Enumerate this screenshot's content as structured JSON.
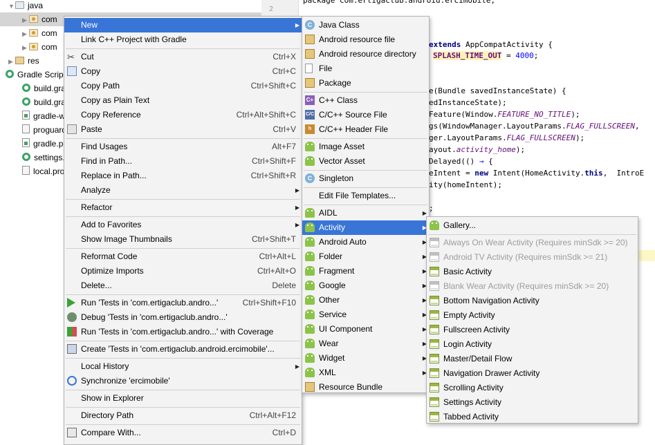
{
  "project_tree": {
    "items": [
      {
        "label": "java",
        "icon": "folder-icon",
        "arrow": "▼"
      },
      {
        "label": "com",
        "icon": "package-icon",
        "arrow": "▶"
      },
      {
        "label": "com",
        "icon": "package-icon",
        "arrow": "▶"
      },
      {
        "label": "com",
        "icon": "package-icon",
        "arrow": "▶"
      },
      {
        "label": "res",
        "icon": "res-folder-icon",
        "arrow": "▶"
      },
      {
        "label": "Gradle Script",
        "icon": "gradle-icon",
        "arrow": ""
      },
      {
        "label": "build.gra",
        "icon": "gradle-ring-icon",
        "arrow": ""
      },
      {
        "label": "build.gra",
        "icon": "gradle-ring-icon",
        "arrow": ""
      },
      {
        "label": "gradle-w",
        "icon": "gradle-file-icon",
        "arrow": ""
      },
      {
        "label": "proguard",
        "icon": "properties-file-icon",
        "arrow": ""
      },
      {
        "label": "gradle.p",
        "icon": "gradle-file-icon",
        "arrow": ""
      },
      {
        "label": "settings.",
        "icon": "gradle-ring-icon",
        "arrow": ""
      },
      {
        "label": "local.pro",
        "icon": "properties-file-icon",
        "arrow": ""
      }
    ]
  },
  "editor": {
    "line_number": "2",
    "lines": [
      {
        "parts": [
          {
            "t": "package com.ertigaclub.android.ercimobile;",
            "c": ""
          }
        ]
      },
      {
        "parts": [
          {
            "t": "extends",
            "c": "kw"
          },
          {
            "t": " AppCompatActivity {",
            "c": ""
          }
        ]
      },
      {
        "parts": [
          {
            "t": "SPLASH_TIME_OUT",
            "c": "st hl"
          },
          {
            "t": " = ",
            "c": ""
          },
          {
            "t": "4000",
            "c": "num"
          },
          {
            "t": ";",
            "c": ""
          }
        ]
      },
      {
        "parts": [
          {
            "t": "e(Bundle savedInstanceState) {",
            "c": ""
          }
        ]
      },
      {
        "parts": [
          {
            "t": "edInstanceState);",
            "c": ""
          }
        ]
      },
      {
        "parts": [
          {
            "t": "Feature(Window.",
            "c": ""
          },
          {
            "t": "FEATURE_NO_TITLE",
            "c": "it"
          },
          {
            "t": ");",
            "c": ""
          }
        ]
      },
      {
        "parts": [
          {
            "t": "gs(WindowManager.LayoutParams.",
            "c": ""
          },
          {
            "t": "FLAG_FULLSCREEN",
            "c": "it"
          },
          {
            "t": ",",
            "c": ""
          }
        ]
      },
      {
        "parts": [
          {
            "t": "ger.LayoutParams.",
            "c": ""
          },
          {
            "t": "FLAG_FULLSCREEN",
            "c": "it"
          },
          {
            "t": ");",
            "c": ""
          }
        ]
      },
      {
        "parts": [
          {
            "t": "ayout.",
            "c": ""
          },
          {
            "t": "activity_home",
            "c": "it"
          },
          {
            "t": ");",
            "c": ""
          }
        ]
      },
      {
        "parts": [
          {
            "t": "Delayed(() ",
            "c": ""
          },
          {
            "t": "→",
            "c": "num"
          },
          {
            "t": " {",
            "c": ""
          }
        ]
      },
      {
        "parts": [
          {
            "t": "eIntent = ",
            "c": ""
          },
          {
            "t": "new",
            "c": "kw"
          },
          {
            "t": " Intent(HomeActivity.",
            "c": ""
          },
          {
            "t": "this",
            "c": "kw"
          },
          {
            "t": ",  IntroE",
            "c": ""
          }
        ]
      },
      {
        "parts": [
          {
            "t": "ity(homeIntent);",
            "c": ""
          }
        ]
      },
      {
        "parts": [
          {
            "t": ";",
            "c": ""
          }
        ]
      }
    ]
  },
  "context_menu": {
    "items": [
      {
        "type": "item",
        "label": "New",
        "highlighted": true,
        "submenu": true
      },
      {
        "type": "item",
        "label": "Link C++ Project with Gradle"
      },
      {
        "type": "sep"
      },
      {
        "type": "item",
        "label": "Cut",
        "shortcut": "Ctrl+X",
        "icon": "cut-icon"
      },
      {
        "type": "item",
        "label": "Copy",
        "shortcut": "Ctrl+C",
        "icon": "copy-icon"
      },
      {
        "type": "item",
        "label": "Copy Path",
        "shortcut": "Ctrl+Shift+C"
      },
      {
        "type": "item",
        "label": "Copy as Plain Text"
      },
      {
        "type": "item",
        "label": "Copy Reference",
        "shortcut": "Ctrl+Alt+Shift+C"
      },
      {
        "type": "item",
        "label": "Paste",
        "shortcut": "Ctrl+V",
        "icon": "paste-icon"
      },
      {
        "type": "sep"
      },
      {
        "type": "item",
        "label": "Find Usages",
        "shortcut": "Alt+F7"
      },
      {
        "type": "item",
        "label": "Find in Path...",
        "shortcut": "Ctrl+Shift+F"
      },
      {
        "type": "item",
        "label": "Replace in Path...",
        "shortcut": "Ctrl+Shift+R"
      },
      {
        "type": "item",
        "label": "Analyze",
        "submenu": true
      },
      {
        "type": "sep"
      },
      {
        "type": "item",
        "label": "Refactor",
        "submenu": true
      },
      {
        "type": "sep"
      },
      {
        "type": "item",
        "label": "Add to Favorites",
        "submenu": true
      },
      {
        "type": "item",
        "label": "Show Image Thumbnails",
        "shortcut": "Ctrl+Shift+T"
      },
      {
        "type": "sep"
      },
      {
        "type": "item",
        "label": "Reformat Code",
        "shortcut": "Ctrl+Alt+L"
      },
      {
        "type": "item",
        "label": "Optimize Imports",
        "shortcut": "Ctrl+Alt+O"
      },
      {
        "type": "item",
        "label": "Delete...",
        "shortcut": "Delete"
      },
      {
        "type": "sep"
      },
      {
        "type": "item",
        "label": "Run 'Tests in 'com.ertigaclub.andro...'",
        "shortcut": "Ctrl+Shift+F10",
        "icon": "run-icon"
      },
      {
        "type": "item",
        "label": "Debug 'Tests in 'com.ertigaclub.andro...'",
        "icon": "debug-icon"
      },
      {
        "type": "item",
        "label": "Run 'Tests in 'com.ertigaclub.andro...' with Coverage",
        "icon": "coverage-icon"
      },
      {
        "type": "sep"
      },
      {
        "type": "item",
        "label": "Create 'Tests in 'com.ertigaclub.android.ercimobile'...",
        "icon": "create-test-icon"
      },
      {
        "type": "sep"
      },
      {
        "type": "item",
        "label": "Local History",
        "submenu": true
      },
      {
        "type": "item",
        "label": "Synchronize 'ercimobile'",
        "icon": "sync-icon"
      },
      {
        "type": "sep"
      },
      {
        "type": "item",
        "label": "Show in Explorer"
      },
      {
        "type": "sep"
      },
      {
        "type": "item",
        "label": "Directory Path",
        "shortcut": "Ctrl+Alt+F12"
      },
      {
        "type": "sep"
      },
      {
        "type": "item",
        "label": "Compare With...",
        "shortcut": "Ctrl+D",
        "icon": "compare-icon"
      }
    ]
  },
  "new_menu": {
    "items": [
      {
        "type": "item",
        "label": "Java Class",
        "icon": "java-class-icon"
      },
      {
        "type": "item",
        "label": "Android resource file",
        "icon": "resource-file-icon"
      },
      {
        "type": "item",
        "label": "Android resource directory",
        "icon": "resource-directory-icon"
      },
      {
        "type": "item",
        "label": "File",
        "icon": "file-icon"
      },
      {
        "type": "item",
        "label": "Package",
        "icon": "package-icon"
      },
      {
        "type": "sep"
      },
      {
        "type": "item",
        "label": "C++ Class",
        "icon": "cpp-class-icon"
      },
      {
        "type": "item",
        "label": "C/C++ Source File",
        "icon": "cpp-source-icon"
      },
      {
        "type": "item",
        "label": "C/C++ Header File",
        "icon": "cpp-header-icon"
      },
      {
        "type": "sep"
      },
      {
        "type": "item",
        "label": "Image Asset",
        "icon": "android-icon"
      },
      {
        "type": "item",
        "label": "Vector Asset",
        "icon": "android-icon"
      },
      {
        "type": "sep"
      },
      {
        "type": "item",
        "label": "Singleton",
        "icon": "java-class-icon"
      },
      {
        "type": "sep"
      },
      {
        "type": "item",
        "label": "Edit File Templates..."
      },
      {
        "type": "sep"
      },
      {
        "type": "item",
        "label": "AIDL",
        "icon": "android-icon",
        "submenu": true
      },
      {
        "type": "item",
        "label": "Activity",
        "icon": "android-icon",
        "submenu": true,
        "highlighted": true
      },
      {
        "type": "item",
        "label": "Android Auto",
        "icon": "android-icon",
        "submenu": true
      },
      {
        "type": "item",
        "label": "Folder",
        "icon": "android-icon",
        "submenu": true
      },
      {
        "type": "item",
        "label": "Fragment",
        "icon": "android-icon",
        "submenu": true
      },
      {
        "type": "item",
        "label": "Google",
        "icon": "android-icon",
        "submenu": true
      },
      {
        "type": "item",
        "label": "Other",
        "icon": "android-icon",
        "submenu": true
      },
      {
        "type": "item",
        "label": "Service",
        "icon": "android-icon",
        "submenu": true
      },
      {
        "type": "item",
        "label": "UI Component",
        "icon": "android-icon",
        "submenu": true
      },
      {
        "type": "item",
        "label": "Wear",
        "icon": "android-icon",
        "submenu": true
      },
      {
        "type": "item",
        "label": "Widget",
        "icon": "android-icon",
        "submenu": true
      },
      {
        "type": "item",
        "label": "XML",
        "icon": "android-icon",
        "submenu": true
      },
      {
        "type": "item",
        "label": "Resource Bundle",
        "icon": "resource-bundle-icon"
      }
    ]
  },
  "activity_menu": {
    "items": [
      {
        "type": "item",
        "label": "Gallery...",
        "icon": "android-icon"
      },
      {
        "type": "sep"
      },
      {
        "type": "item",
        "label": "Always On Wear Activity (Requires minSdk >= 20)",
        "disabled": true,
        "icon": "activity-template-icon"
      },
      {
        "type": "item",
        "label": "Android TV Activity (Requires minSdk >= 21)",
        "disabled": true,
        "icon": "activity-template-icon"
      },
      {
        "type": "item",
        "label": "Basic Activity",
        "icon": "activity-template-icon"
      },
      {
        "type": "item",
        "label": "Blank Wear Activity (Requires minSdk >= 20)",
        "disabled": true,
        "icon": "activity-template-icon"
      },
      {
        "type": "item",
        "label": "Bottom Navigation Activity",
        "icon": "activity-template-icon"
      },
      {
        "type": "item",
        "label": "Empty Activity",
        "icon": "activity-template-icon"
      },
      {
        "type": "item",
        "label": "Fullscreen Activity",
        "icon": "activity-template-icon"
      },
      {
        "type": "item",
        "label": "Login Activity",
        "icon": "activity-template-icon"
      },
      {
        "type": "item",
        "label": "Master/Detail Flow",
        "icon": "activity-template-icon"
      },
      {
        "type": "item",
        "label": "Navigation Drawer Activity",
        "icon": "activity-template-icon"
      },
      {
        "type": "item",
        "label": "Scrolling Activity",
        "icon": "activity-template-icon"
      },
      {
        "type": "item",
        "label": "Settings Activity",
        "icon": "activity-template-icon"
      },
      {
        "type": "item",
        "label": "Tabbed Activity",
        "icon": "activity-template-icon"
      }
    ]
  },
  "colors": {
    "highlight": "#3875d7",
    "menu_bg": "#f3f3f3",
    "disabled_text": "#9c9c9c",
    "android_green": "#8cc34a"
  }
}
